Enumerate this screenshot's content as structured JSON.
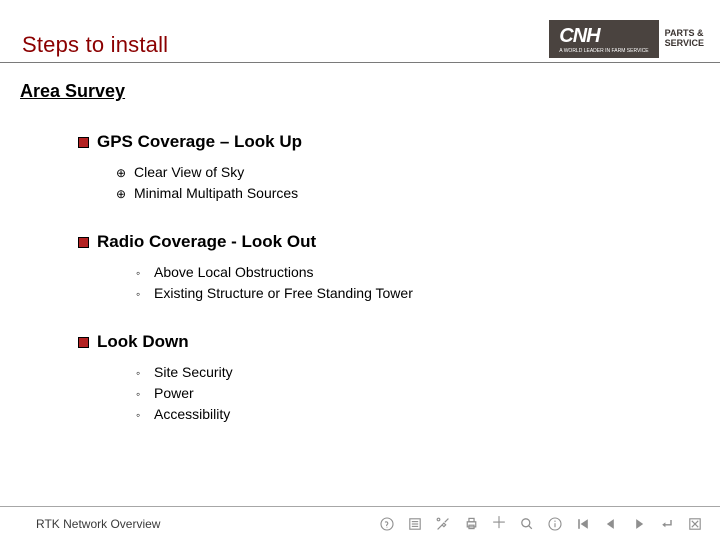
{
  "header": {
    "title": "Steps to  install",
    "logo_text": "CNH",
    "logo_sub": "A WORLD LEADER IN FARM SERVICE",
    "tagline1": "PARTS &",
    "tagline2": "SERVICE"
  },
  "subheading": "Area Survey",
  "topics": [
    {
      "title": "GPS Coverage – Look Up",
      "bullet_style": "crosshair",
      "items": [
        "Clear View of Sky",
        "Minimal Multipath Sources"
      ]
    },
    {
      "title": "Radio Coverage - Look Out",
      "bullet_style": "ring",
      "items": [
        "Above Local Obstructions",
        "Existing Structure or Free Standing Tower"
      ]
    },
    {
      "title": "Look Down",
      "bullet_style": "ring",
      "items": [
        "Site Security",
        "Power",
        "Accessibility"
      ]
    }
  ],
  "footer": {
    "label": "RTK Network Overview"
  }
}
